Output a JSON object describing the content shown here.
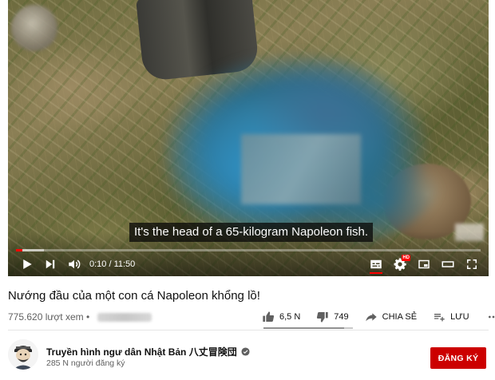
{
  "player": {
    "subtitle": "It's the head of a 65-kilogram Napoleon fish.",
    "time_display": "0:10 / 11:50",
    "progress": 0.014,
    "buffered": 0.06,
    "hd_badge": "HD",
    "controls": [
      "play-icon",
      "next-icon",
      "volume-icon",
      "captions-icon",
      "settings-icon",
      "miniplayer-icon",
      "theater-icon",
      "fullscreen-icon"
    ]
  },
  "video": {
    "title": "Nướng đầu của một con cá Napoleon khổng lồ!",
    "views": "775.620 lượt xem",
    "views_separator": " • "
  },
  "actions": {
    "like_count": "6,5 N",
    "dislike_count": "749",
    "share_label": "CHIA SẺ",
    "save_label": "LƯU",
    "like_ratio": 0.9
  },
  "channel": {
    "name": "Truyền hình ngư dân Nhật Bản 八丈冒険団",
    "subscribers": "285 N người đăng ký",
    "subscribe_label": "ĐĂNG KÝ"
  },
  "colors": {
    "accent": "#ff0000",
    "subscribe_bg": "#cc0000",
    "secondary_text": "#606060"
  }
}
